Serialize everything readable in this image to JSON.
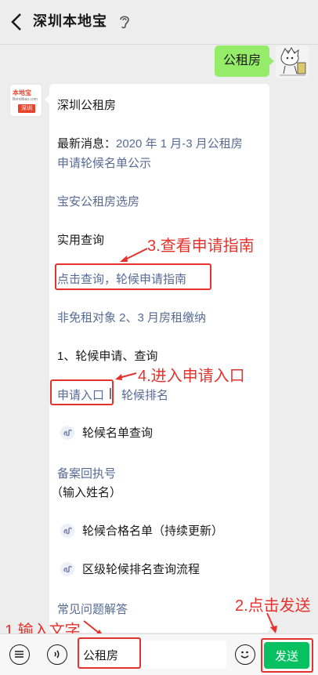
{
  "header": {
    "title": "深圳本地宝"
  },
  "user_message": {
    "text": "公租房"
  },
  "reply": {
    "sender_logo": {
      "brand": "本地宝",
      "sub": "Bendibao.com",
      "city": "深圳"
    },
    "lines": {
      "heading": "深圳公租房",
      "news_prefix": "最新消息：",
      "news_link_1": "2020 年 1 月-3 月公租房",
      "news_link_2": "申请轮候名单公示",
      "baoan": "宝安公租房选房",
      "practical": "实用查询",
      "guide": "点击查询，轮候申请指南",
      "rent": "非免租对象 2、3 月房租缴纳",
      "apply_query": "1、轮候申请、查询",
      "apply_entry": "申请入口",
      "separator": " | ",
      "rank": "轮候排名",
      "waitlist": "轮候名单查询",
      "receipt": "备案回执号",
      "name_hint": "（输入姓名）",
      "qualified": "轮候合格名单（持续更新）",
      "district": "区级轮候排名查询流程",
      "faq": "常见问题解答"
    }
  },
  "annotations": {
    "step1": "1.输入文字",
    "step2": "2.点击发送",
    "step3": "3.查看申请指南",
    "step4": "4.进入申请入口"
  },
  "input_bar": {
    "value": "公租房",
    "send_label": "发送"
  },
  "colors": {
    "send": "#07c160",
    "bubble_out": "#95ec69",
    "link": "#576b95",
    "annotation": "#e5322d"
  }
}
